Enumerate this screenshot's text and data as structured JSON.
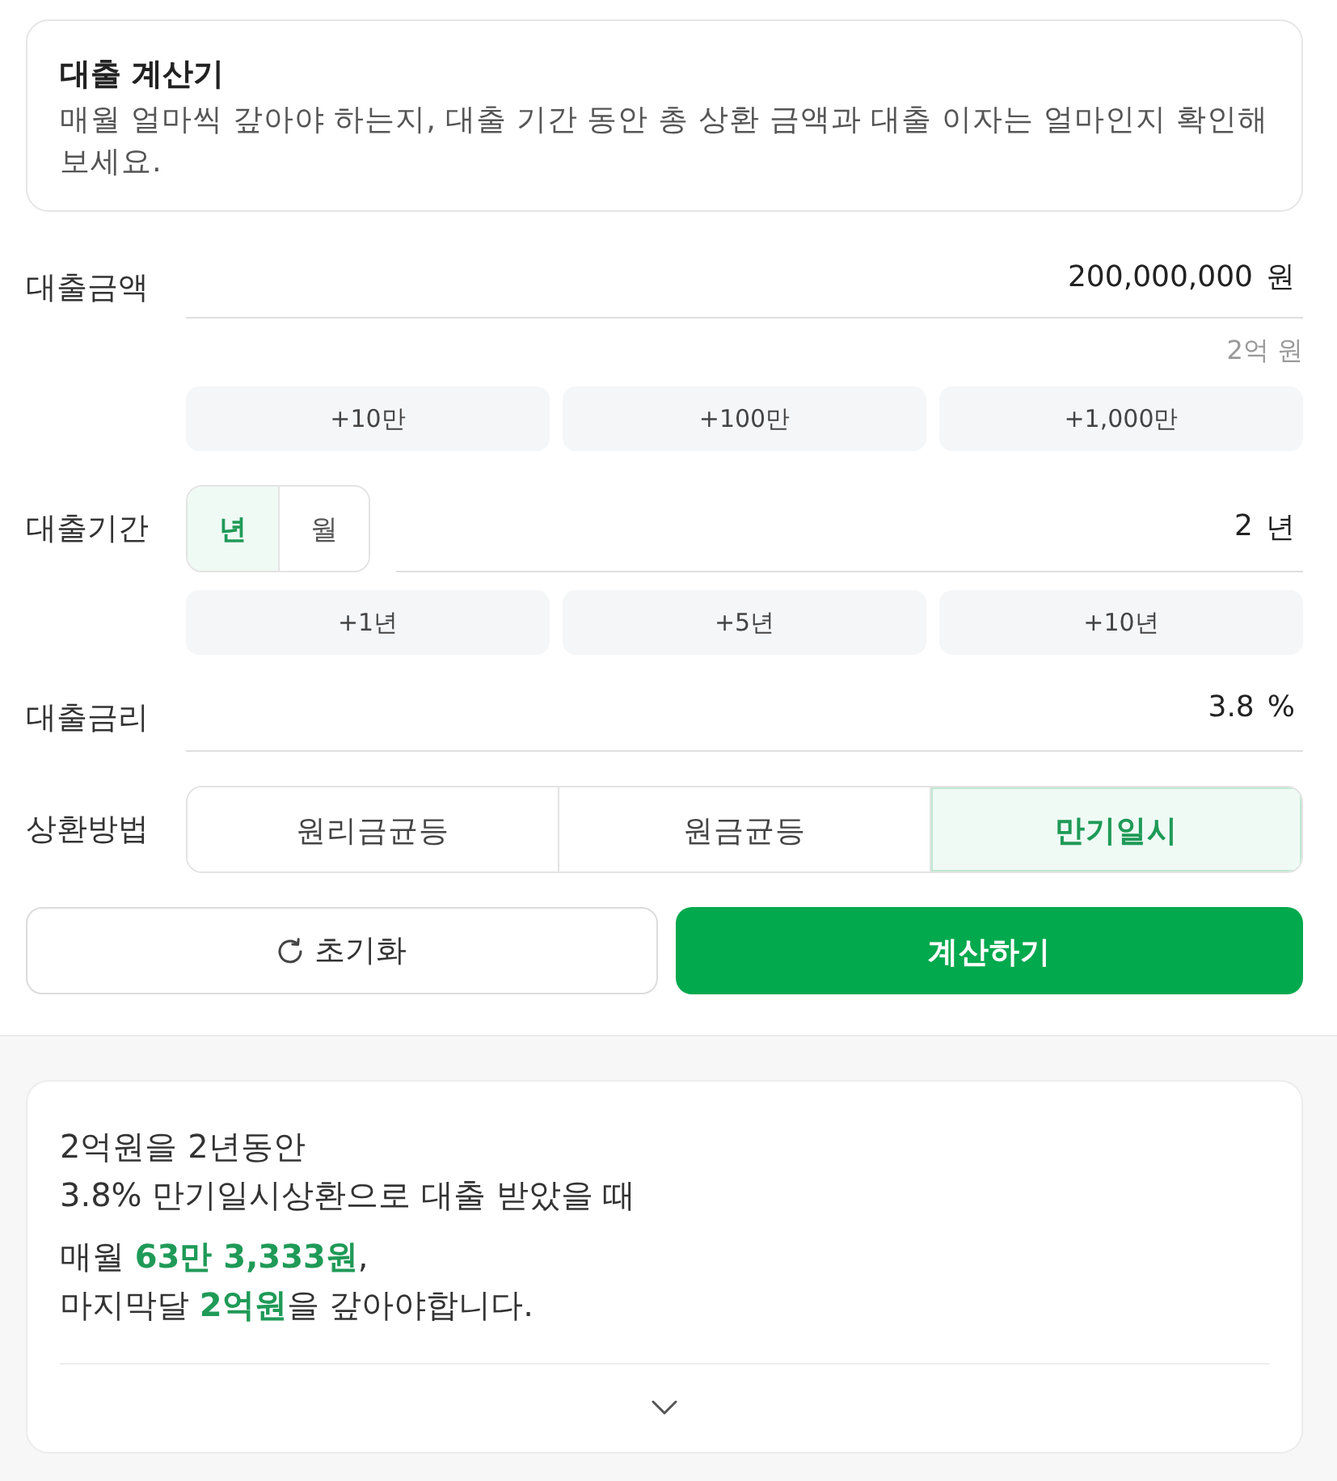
{
  "intro": {
    "title": "대출 계산기",
    "description": "매월 얼마씩 갚아야 하는지, 대출 기간 동안 총 상환 금액과 대출 이자는 얼마인지 확인해 보세요."
  },
  "amount": {
    "label": "대출금액",
    "value": "200,000,000",
    "unit": "원",
    "hint": "2억 원",
    "quick_buttons": [
      "+10만",
      "+100만",
      "+1,000만"
    ]
  },
  "period": {
    "label": "대출기간",
    "unit_toggle": [
      {
        "label": "년",
        "selected": true
      },
      {
        "label": "월",
        "selected": false
      }
    ],
    "value": "2",
    "unit": "년",
    "quick_buttons": [
      "+1년",
      "+5년",
      "+10년"
    ]
  },
  "rate": {
    "label": "대출금리",
    "value": "3.8",
    "unit": "%"
  },
  "method": {
    "label": "상환방법",
    "options": [
      {
        "label": "원리금균등",
        "selected": false
      },
      {
        "label": "원금균등",
        "selected": false
      },
      {
        "label": "만기일시",
        "selected": true
      }
    ]
  },
  "actions": {
    "reset": "초기화",
    "calculate": "계산하기"
  },
  "result": {
    "conditions": [
      "2억원을 2년동안",
      "3.8% 만기일시상환으로 대출 받았을 때"
    ],
    "summary": [
      "매월 **63만 3,333원**,",
      "마지막달 **2억원**을 갚아야합니다."
    ]
  }
}
